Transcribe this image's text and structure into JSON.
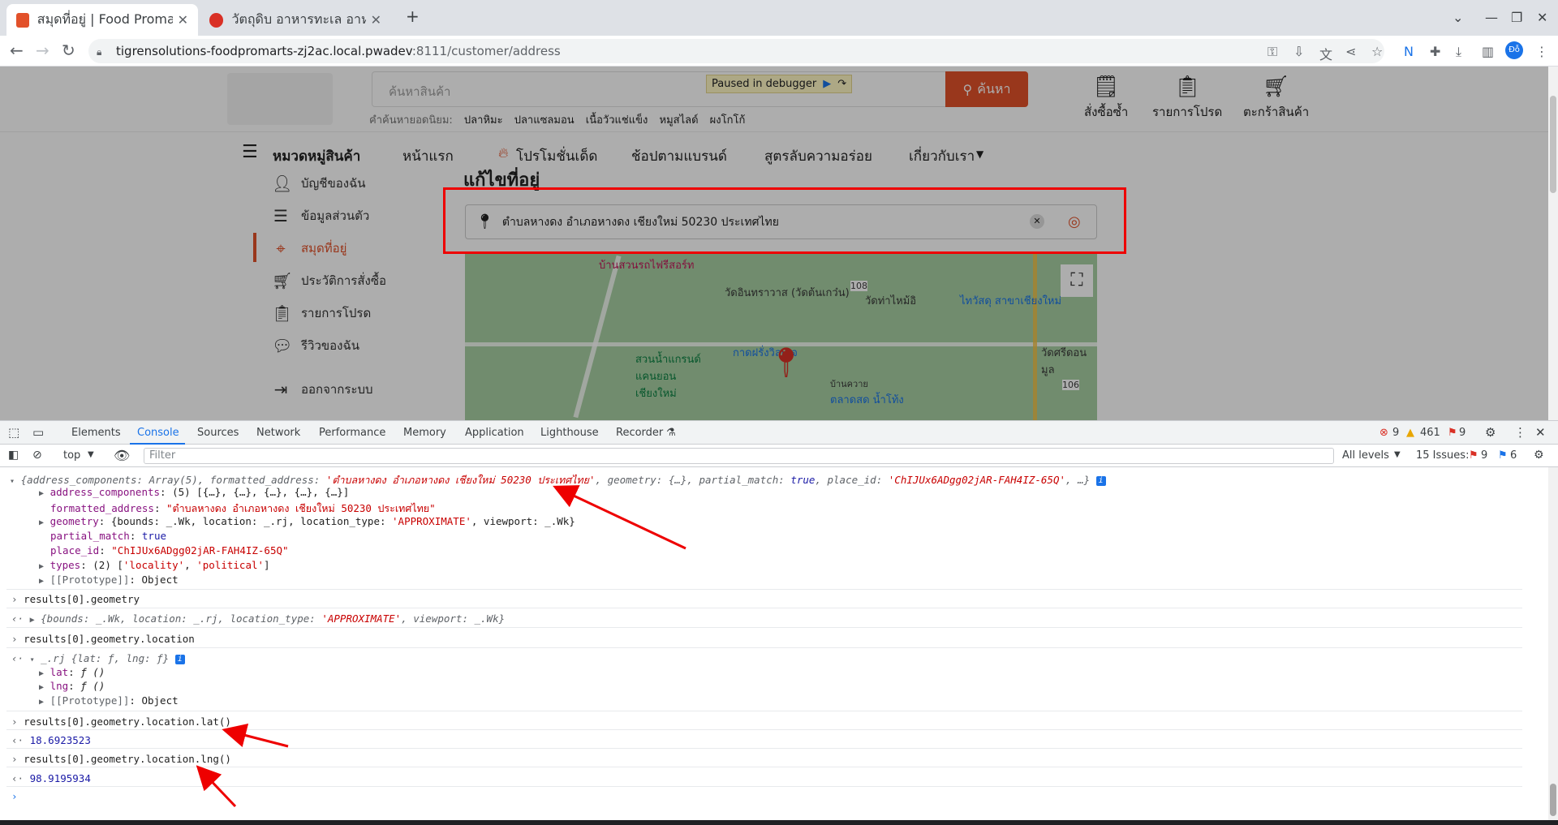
{
  "browser": {
    "tabs": [
      {
        "title": "สมุดที่อยู่ | Food Promart",
        "active": true
      },
      {
        "title": "วัตถุดิบ อาหารทะเล อาหาร",
        "active": false
      }
    ],
    "new_tab": "+",
    "url_host": "tigrensolutions-foodpromarts-zj2ac.local.pwadev",
    "url_rest": ":8111/customer/address",
    "profile": "Đỗ"
  },
  "site": {
    "search_placeholder": "ค้นหาสินค้า",
    "search_button": "ค้นหา",
    "paused_label": "Paused in debugger",
    "popular_label": "คำค้นหายอดนิยม:",
    "popular": [
      "ปลาหิมะ",
      "ปลาแซลมอน",
      "เนื้อวัวแช่แข็ง",
      "หมูสไลด์",
      "ผงโกโก้"
    ],
    "header_icons": [
      "สั่งซื้อซ้ำ",
      "รายการโปรด",
      "ตะกร้าสินค้า"
    ],
    "nav": {
      "categories": "หมวดหมู่สินค้า",
      "items": [
        "หน้าแรก",
        "โปรโมชั่นเด็ด",
        "ช้อปตามแบรนด์",
        "สูตรลับความอร่อย",
        "เกี่ยวกับเรา"
      ]
    },
    "sidebar": [
      "บัญชีของฉัน",
      "ข้อมูลส่วนตัว",
      "สมุดที่อยู่",
      "ประวัติการสั่งซื้อ",
      "รายการโปรด",
      "รีวิวของฉัน",
      "ออกจากระบบ"
    ],
    "address_title": "แก้ไขที่อยู่",
    "address_value": "ตำบลหางดง อำเภอหางดง เชียงใหม่ 50230 ประเทศไทย",
    "map_labels": [
      "บ้านสวนรถไฟรีสอร์ท",
      "วัดอินทราวาส (วัดต้นเกว๋น)",
      "108",
      "วัดท่าไหม้อิ",
      "ไทวัสดุ สาขาเชียงใหม่",
      "สวนน้ำแกรนด์ แคนยอน เชียงใหม่",
      "กาดฝรั่งวิลเลจ",
      "วัดศรีดอนมูล",
      "บ้านควาย",
      "ตลาดสด น้ำโท้ง",
      "106"
    ]
  },
  "devtools": {
    "tabs": [
      "Elements",
      "Console",
      "Sources",
      "Network",
      "Performance",
      "Memory",
      "Application",
      "Lighthouse",
      "Recorder"
    ],
    "errors": "9",
    "warnings": "461",
    "issues_badge": "9",
    "context": "top",
    "filter_placeholder": "Filter",
    "levels": "All levels",
    "issues_label": "15 Issues:",
    "issues_err": "9",
    "issues_info": "6",
    "console": {
      "obj_summary_a": "{address_components: Array(5), formatted_address: ",
      "obj_summary_str": "'ตำบลหางดง อำเภอหางดง เชียงใหม่ 50230 ประเทศไทย'",
      "obj_summary_b": ", geometry: {…}, partial_match: ",
      "obj_summary_true": "true",
      "obj_summary_c": ", place_id: ",
      "obj_summary_pid": "'ChIJUx6ADgg02jAR-FAH4IZ-65Q'",
      "obj_summary_d": ", …}",
      "addr_comp_key": "address_components",
      "addr_comp_val": "(5) [{…}, {…}, {…}, {…}, {…}]",
      "fa_key": "formatted_address",
      "fa_val": "\"ตำบลหางดง อำเภอหางดง เชียงใหม่ 50230 ประเทศไทย\"",
      "geo_key": "geometry",
      "geo_val_a": "{bounds: _.Wk, location: _.rj, location_type: ",
      "geo_val_str": "'APPROXIMATE'",
      "geo_val_b": ", viewport: _.Wk}",
      "pm_key": "partial_match",
      "pm_val": "true",
      "pid_key": "place_id",
      "pid_val": "\"ChIJUx6ADgg02jAR-FAH4IZ-65Q\"",
      "types_key": "types",
      "types_val_a": "(2) [",
      "types_val_s1": "'locality'",
      "types_val_sep": ", ",
      "types_val_s2": "'political'",
      "types_val_b": "]",
      "proto_key": "[[Prototype]]",
      "proto_val": "Object",
      "cmd1": "results[0].geometry",
      "res1_a": "{bounds: _.Wk, location: _.rj, location_type: ",
      "res1_str": "'APPROXIMATE'",
      "res1_b": ", viewport: _.Wk}",
      "cmd2": "results[0].geometry.location",
      "res2": "_.rj {lat: ƒ, lng: ƒ}",
      "lat_key": "lat",
      "lat_val": "ƒ ()",
      "lng_key": "lng",
      "lng_val": "ƒ ()",
      "cmd3": "results[0].geometry.location.lat()",
      "res3": "18.6923523",
      "cmd4": "results[0].geometry.location.lng()",
      "res4": "98.9195934"
    }
  }
}
